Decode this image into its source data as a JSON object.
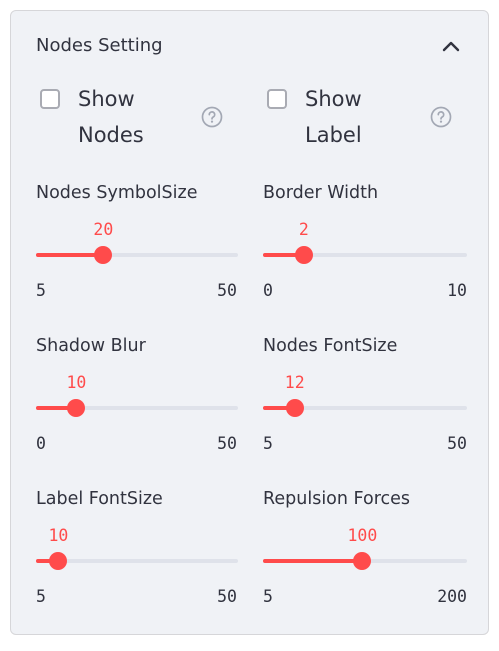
{
  "panel": {
    "title": "Nodes Setting",
    "expanded": true,
    "icon": "chevron-up-icon"
  },
  "checkboxes": [
    {
      "id": "show-nodes",
      "label": "Show Nodes",
      "checked": false,
      "help_icon": "question-circle-icon"
    },
    {
      "id": "show-label",
      "label": "Show Label",
      "checked": false,
      "help_icon": "question-circle-icon"
    }
  ],
  "sliders": [
    {
      "id": "nodes-symbolsize",
      "label": "Nodes SymbolSize",
      "value": 20,
      "min": 5,
      "max": 50,
      "value_text": "20",
      "min_text": "5",
      "max_text": "50"
    },
    {
      "id": "border-width",
      "label": "Border Width",
      "value": 2,
      "min": 0,
      "max": 10,
      "value_text": "2",
      "min_text": "0",
      "max_text": "10"
    },
    {
      "id": "shadow-blur",
      "label": "Shadow Blur",
      "value": 10,
      "min": 0,
      "max": 50,
      "value_text": "10",
      "min_text": "0",
      "max_text": "50"
    },
    {
      "id": "nodes-fontsize",
      "label": "Nodes FontSize",
      "value": 12,
      "min": 5,
      "max": 50,
      "value_text": "12",
      "min_text": "5",
      "max_text": "50"
    },
    {
      "id": "label-fontsize",
      "label": "Label FontSize",
      "value": 10,
      "min": 5,
      "max": 50,
      "value_text": "10",
      "min_text": "5",
      "max_text": "50"
    },
    {
      "id": "repulsion-forces",
      "label": "Repulsion Forces",
      "value": 100,
      "min": 5,
      "max": 200,
      "value_text": "100",
      "min_text": "5",
      "max_text": "200"
    }
  ],
  "colors": {
    "accent": "#ff4b4b",
    "track": "#dfe2ea",
    "panel_bg": "#f0f2f6",
    "text": "#31333f",
    "icon": "#a3a8b4"
  }
}
